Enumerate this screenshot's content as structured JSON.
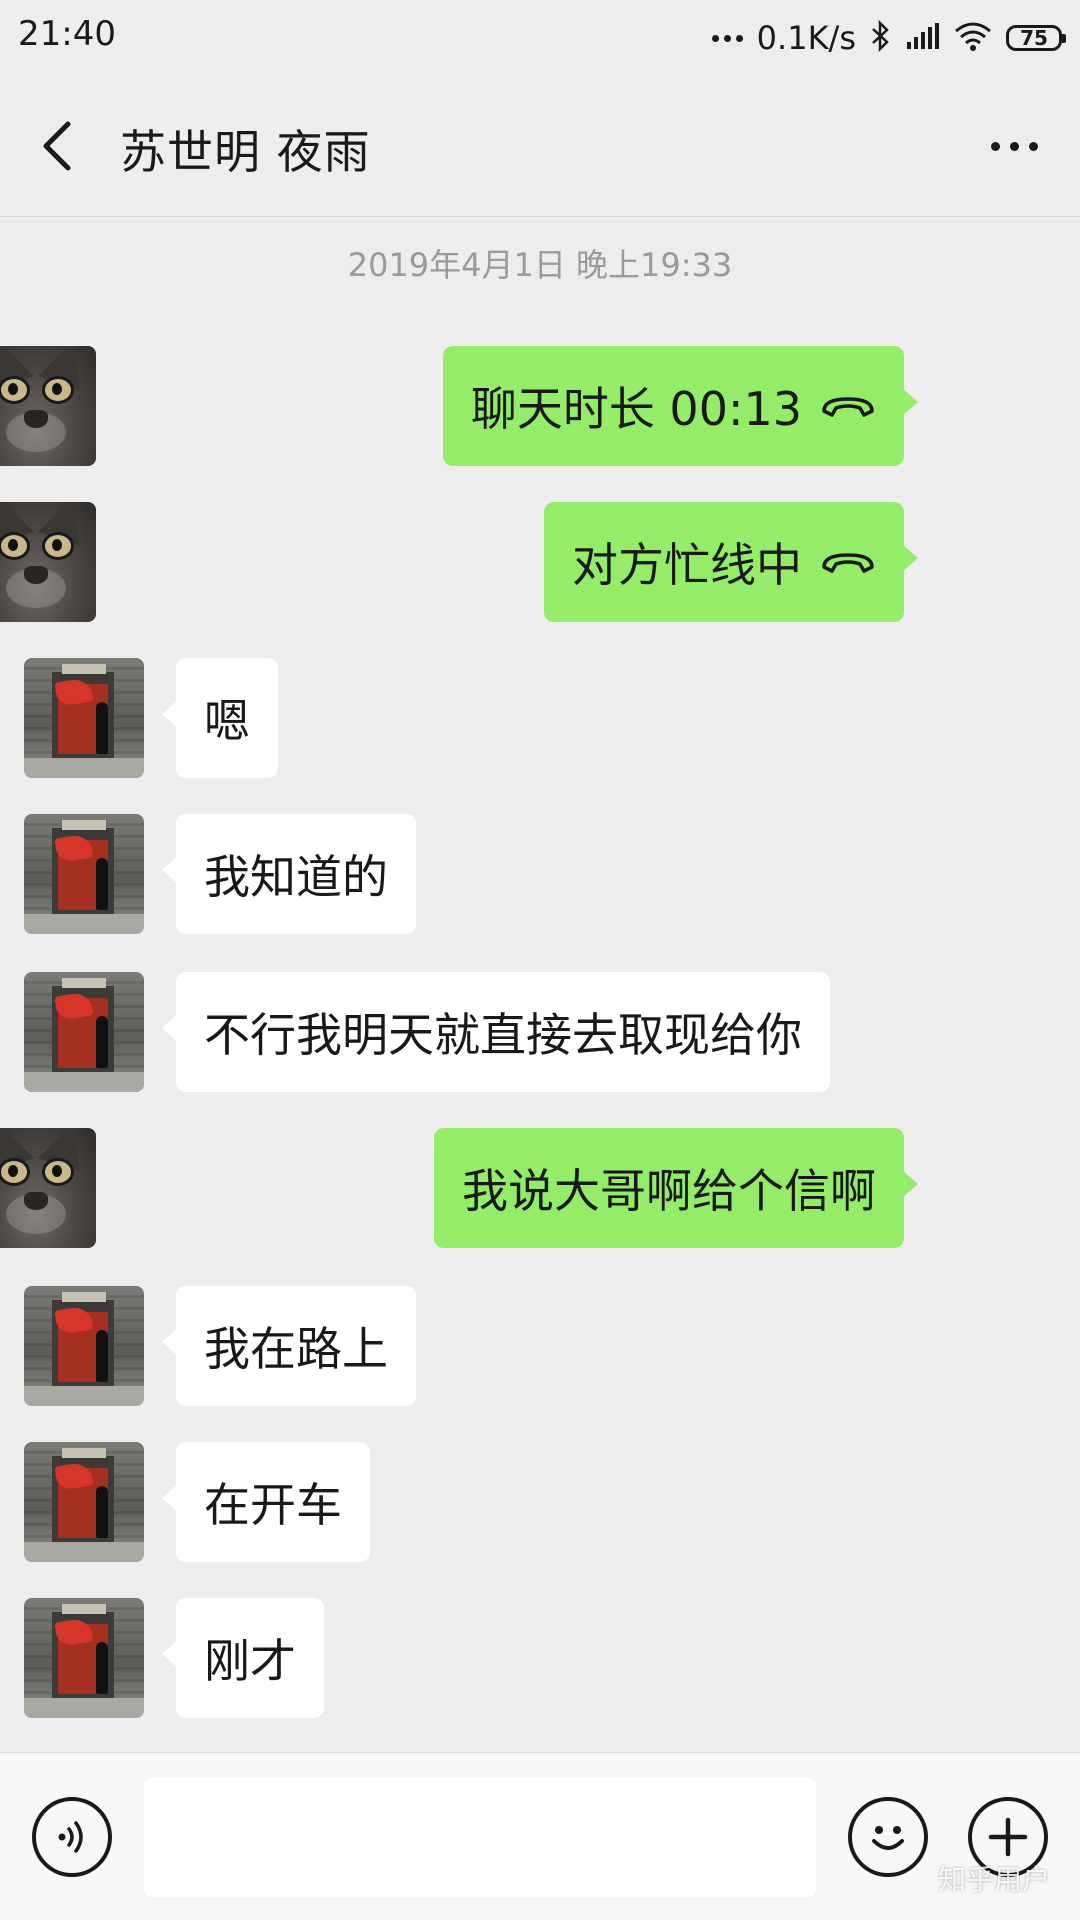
{
  "status_bar": {
    "time": "21:40",
    "network_speed": "0.1K/s",
    "battery_level": "75",
    "icons": [
      "more-dots-icon",
      "bluetooth-icon",
      "signal-icon",
      "wifi-icon",
      "battery-icon"
    ]
  },
  "header": {
    "contact_name": "苏世明 夜雨",
    "back_icon": "chevron-left-icon",
    "more_icon": "more-dots-icon"
  },
  "chat": {
    "timestamp": "2019年4月1日 晚上19:33",
    "messages": [
      {
        "side": "right",
        "text": "聊天时长 00:13",
        "icon": "phone-hangup-icon",
        "avatar": "cat-avatar"
      },
      {
        "side": "right",
        "text": "对方忙线中",
        "icon": "phone-hangup-icon",
        "avatar": "cat-avatar"
      },
      {
        "side": "left",
        "text": "嗯",
        "avatar": "door-avatar"
      },
      {
        "side": "left",
        "text": "我知道的",
        "avatar": "door-avatar"
      },
      {
        "side": "left",
        "text": "不行我明天就直接去取现给你",
        "avatar": "door-avatar"
      },
      {
        "side": "right",
        "text": "我说大哥啊给个信啊",
        "avatar": "cat-avatar"
      },
      {
        "side": "left",
        "text": "我在路上",
        "avatar": "door-avatar"
      },
      {
        "side": "left",
        "text": "在开车",
        "avatar": "door-avatar"
      },
      {
        "side": "left",
        "text": "刚才",
        "avatar": "door-avatar"
      }
    ]
  },
  "input_bar": {
    "value": "",
    "placeholder": "",
    "icons": [
      "voice-icon",
      "emoji-icon",
      "plus-icon"
    ]
  },
  "watermark": "知乎用户",
  "colors": {
    "background": "#ededed",
    "sent_bubble": "#95ec69",
    "received_bubble": "#ffffff",
    "timestamp_text": "#9a9a9a"
  }
}
